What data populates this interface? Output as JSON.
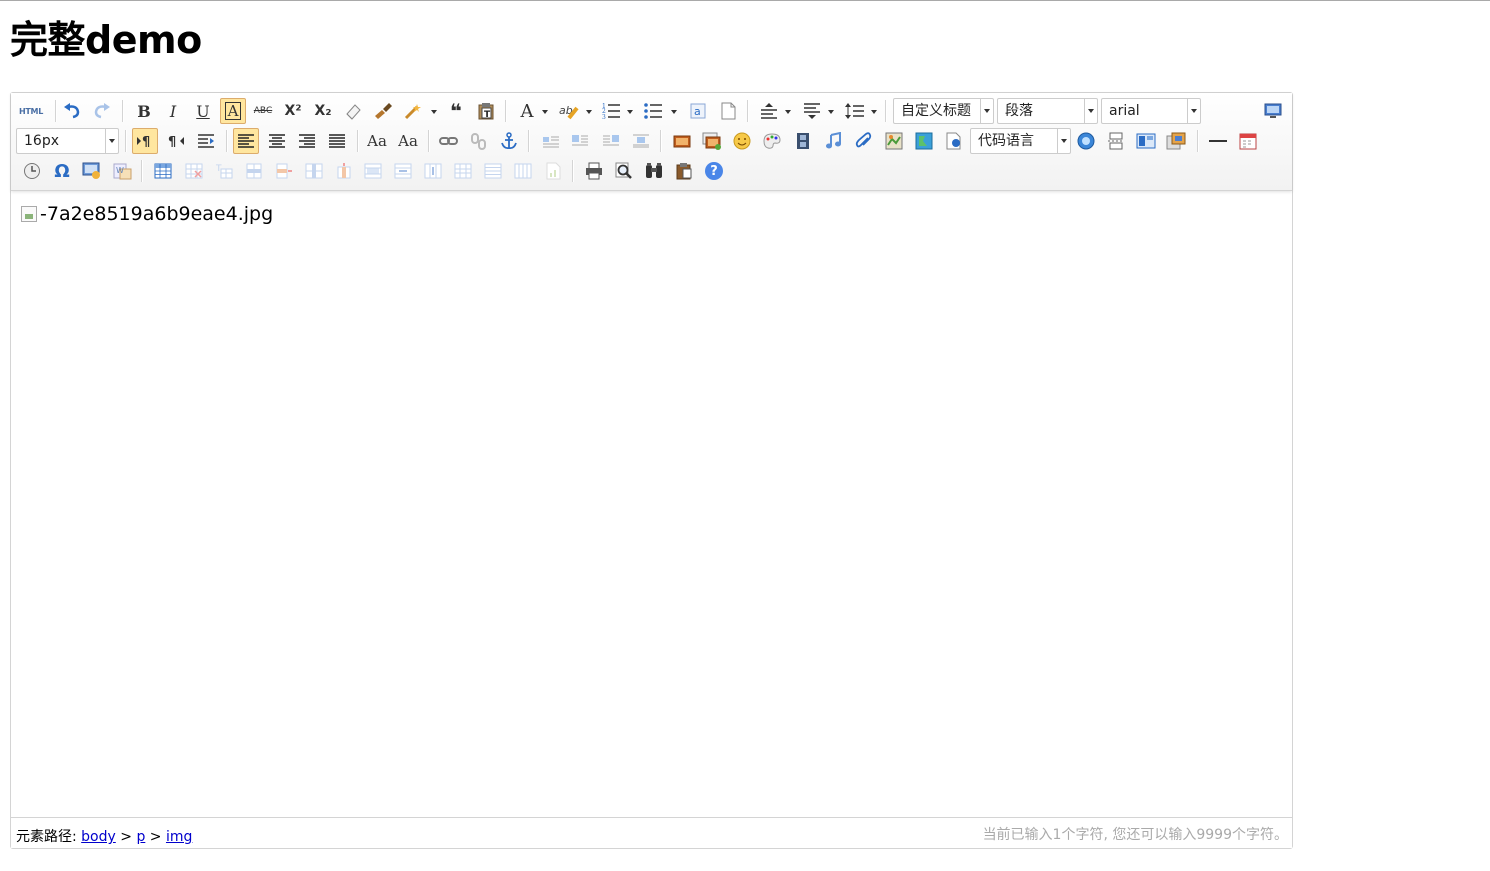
{
  "page": {
    "title": "完整demo"
  },
  "toolbar": {
    "row1": {
      "source": "HTML",
      "combo_title": "自定义标题",
      "combo_paragraph": "段落",
      "combo_font": "arial"
    },
    "row2": {
      "combo_size": "16px",
      "combo_code": "代码语言"
    },
    "icons": {
      "bold": "B",
      "italic": "I",
      "underline": "U",
      "fontborder": "A",
      "strike": "ABC",
      "superscript": "X²",
      "subscript": "X₂",
      "forecolor": "A",
      "case_upper": "Aa",
      "case_lower": "Aa",
      "help": "?"
    }
  },
  "editor": {
    "image_alt": "-7a2e8519a6b9eae4.jpg"
  },
  "statusbar": {
    "path_label": "元素路径:",
    "path": [
      "body",
      "p",
      "img"
    ],
    "separator": ">",
    "word_count": "当前已输入1个字符, 您还可以输入9999个字符。"
  },
  "colors": {
    "active_bg": "#ffe69f",
    "active_border": "#dcac6c",
    "link": "#0000cc",
    "count_text": "#aaaaaa"
  }
}
